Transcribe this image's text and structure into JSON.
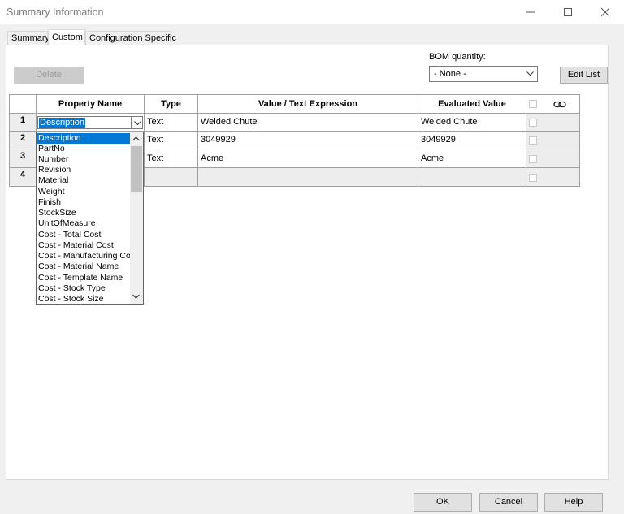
{
  "window": {
    "title": "Summary Information"
  },
  "tabs": [
    {
      "label": "Summary"
    },
    {
      "label": "Custom"
    },
    {
      "label": "Configuration Specific"
    }
  ],
  "toolbar": {
    "delete_label": "Delete",
    "bom_label": "BOM quantity:",
    "bom_value": "- None -",
    "edit_list_label": "Edit List"
  },
  "table": {
    "headers": [
      "Property Name",
      "Type",
      "Value / Text Expression",
      "Evaluated Value"
    ],
    "rows": [
      {
        "num": "1",
        "name": "Description",
        "type": "Text",
        "value": "Welded Chute",
        "evaluated": "Welded Chute"
      },
      {
        "num": "2",
        "name": "",
        "type": "Text",
        "value": "3049929",
        "evaluated": "3049929"
      },
      {
        "num": "3",
        "name": "",
        "type": "Text",
        "value": "Acme",
        "evaluated": "Acme"
      },
      {
        "num": "4",
        "name": "",
        "type": "",
        "value": "",
        "evaluated": ""
      }
    ]
  },
  "dropdown": {
    "items": [
      "Description",
      "PartNo",
      "Number",
      "Revision",
      "Material",
      "Weight",
      "Finish",
      "StockSize",
      "UnitOfMeasure",
      "Cost - Total Cost",
      "Cost - Material Cost",
      "Cost - Manufacturing Cost",
      "Cost - Material Name",
      "Cost - Template Name",
      "Cost - Stock Type",
      "Cost - Stock Size"
    ]
  },
  "footer": {
    "ok": "OK",
    "cancel": "Cancel",
    "help": "Help"
  },
  "colors": {
    "selection": "#0078d7"
  }
}
